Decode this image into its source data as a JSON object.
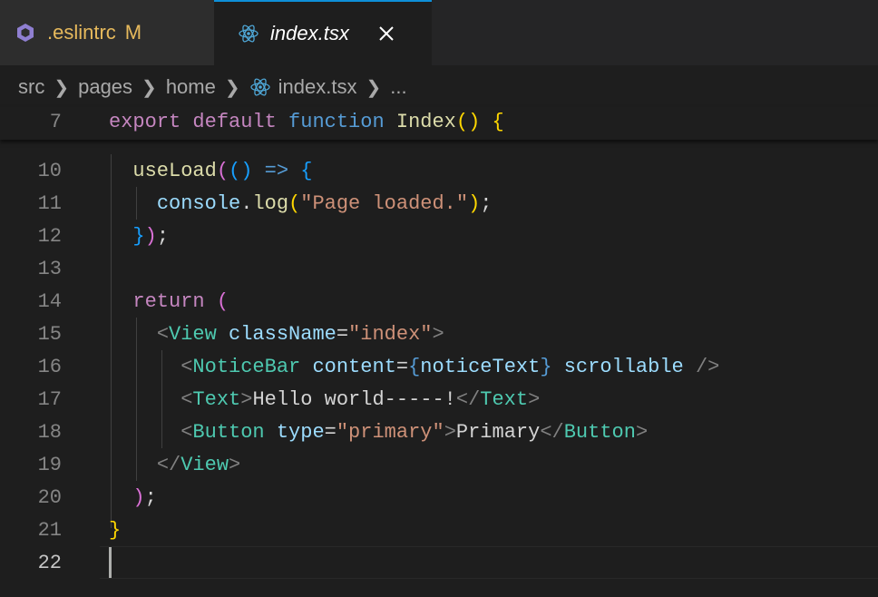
{
  "tabs": [
    {
      "name": ".eslintrc",
      "badge": "M",
      "icon": "eslint-icon",
      "active": false
    },
    {
      "name": "index.tsx",
      "icon": "react-icon",
      "active": true,
      "close": "×"
    }
  ],
  "breadcrumb": [
    "src",
    "pages",
    "home",
    "index.tsx",
    "..."
  ],
  "sticky": {
    "number": "7"
  },
  "lines": [
    {
      "number": "10"
    },
    {
      "number": "11"
    },
    {
      "number": "12"
    },
    {
      "number": "13"
    },
    {
      "number": "14"
    },
    {
      "number": "15"
    },
    {
      "number": "16"
    },
    {
      "number": "17"
    },
    {
      "number": "18"
    },
    {
      "number": "19"
    },
    {
      "number": "20"
    },
    {
      "number": "21"
    },
    {
      "number": "22"
    }
  ],
  "tokens": {
    "l7": [
      "export",
      "default",
      "function",
      "Index",
      "(",
      ")",
      "{"
    ],
    "l10": [
      "useLoad",
      "(",
      "()",
      "=>",
      "{"
    ],
    "l11": [
      "console",
      ".",
      "log",
      "(",
      "\"Page loaded.\"",
      ")",
      ";"
    ],
    "l12": [
      "}",
      ")",
      ";"
    ],
    "l14": [
      "return",
      "("
    ],
    "l15": [
      "<",
      "View",
      "className",
      "=",
      "\"index\"",
      ">"
    ],
    "l16": [
      "<",
      "NoticeBar",
      "content",
      "=",
      "{",
      "noticeText",
      "}",
      "scrollable",
      "/>"
    ],
    "l17": [
      "<",
      "Text",
      ">",
      "Hello world-----!",
      "</",
      "Text",
      ">"
    ],
    "l18": [
      "<",
      "Button",
      "type",
      "=",
      "\"primary\"",
      ">",
      "Primary",
      "</",
      "Button",
      ">"
    ],
    "l19": [
      "</",
      "View",
      ">"
    ],
    "l20": [
      ")",
      ";"
    ],
    "l21": [
      "}"
    ]
  },
  "colors": {
    "accent_tab_border": "#0e8fd8",
    "keyword": "#c586c0",
    "function_keyword": "#569cd6",
    "string": "#ce9178",
    "jsx_tag": "#4ec9b0"
  }
}
